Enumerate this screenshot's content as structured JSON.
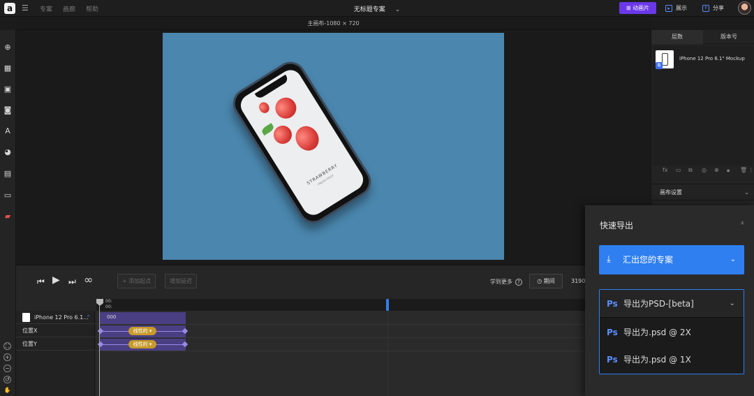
{
  "topbar": {
    "logo": "a",
    "menu": [
      "专案",
      "画廊",
      "帮助"
    ],
    "doc_title": "无标题专案",
    "anim_button": "动画片",
    "show_button": "展示",
    "share_button": "分享"
  },
  "canvas": {
    "label": "主画布-1080 × 720",
    "artboard_color": "#4a86ad",
    "mockup_brand": "STRAWBERRY",
    "mockup_brand_sub": "FRESH FRUIT"
  },
  "timeline": {
    "add_keyframe": "添加起点",
    "add_delay": "增加延迟",
    "learn_more": "学到更多",
    "duration_button": "期间",
    "duration_value": "3190",
    "ruler_label": "00:",
    "ruler_label2": "00:",
    "clip_label": "000",
    "tracks": [
      {
        "label": "iPhone 12 Pro 6.1..."
      },
      {
        "label": "位置X",
        "ease": "线性的 ▾"
      },
      {
        "label": "位置Y",
        "ease": "线性的 ▾"
      }
    ]
  },
  "right_panel": {
    "tabs": [
      "层数",
      "版本号"
    ],
    "layer_name": "iPhone 12 Pro 6.1\" Mockup",
    "canvas_settings": "画布设置"
  },
  "quick_export": {
    "title": "快速导出",
    "main_action": "汇出您的专案",
    "dropdown_selected": "导出为PSD-[beta]",
    "options": [
      "导出为.psd @ 2X",
      "导出为.psd @ 1X"
    ],
    "ps_label": "Ps"
  },
  "colors": {
    "accent_purple": "#6a38e8",
    "accent_blue": "#2f7ff0",
    "ease_badge": "#c79a2a"
  }
}
